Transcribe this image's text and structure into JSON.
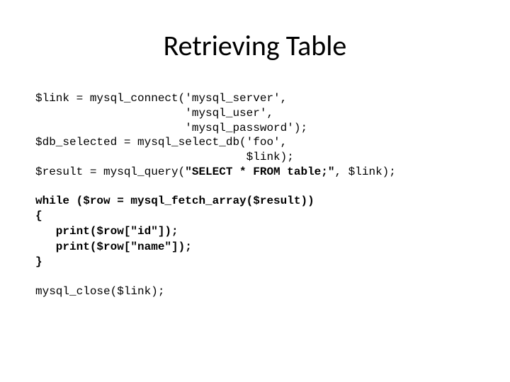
{
  "title": "Retrieving Table",
  "code": {
    "line1": "$link = mysql_connect('mysql_server',",
    "line2": "                      'mysql_user',",
    "line3": "                      'mysql_password');",
    "line4": "$db_selected = mysql_select_db('foo',",
    "line5": "                               $link);",
    "line6a": "$result = mysql_query(",
    "line6b": "\"SELECT * FROM table;\"",
    "line6c": ", $link);"
  },
  "while_block": {
    "line1": "while ($row = mysql_fetch_array($result))",
    "line2": "{",
    "line3": "   print($row[\"id\"]);",
    "line4": "   print($row[\"name\"]);",
    "line5": "}"
  },
  "close_line": "mysql_close($link);"
}
